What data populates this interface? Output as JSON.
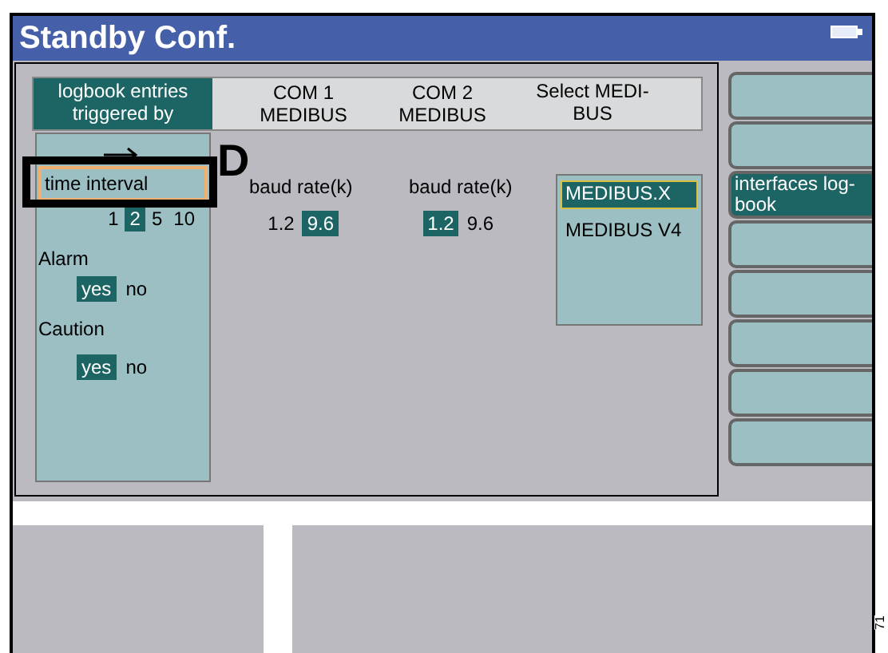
{
  "window": {
    "title": "Standby Conf."
  },
  "header": {
    "logbook_label": "logbook entries triggered by",
    "columns": [
      "COM 1 MEDIBUS",
      "COM 2 MEDIBUS",
      "Select MEDI-BUS"
    ]
  },
  "logbook": {
    "time_interval": {
      "label": "time interval",
      "selected": true
    },
    "interval_options": [
      {
        "label": "1",
        "selected": false
      },
      {
        "label": "2",
        "selected": true
      },
      {
        "label": "5",
        "selected": false
      },
      {
        "label": "10",
        "selected": false
      }
    ],
    "triggers": [
      {
        "label": "Alarm",
        "options": [
          {
            "label": "yes",
            "selected": true
          },
          {
            "label": "no",
            "selected": false
          }
        ]
      },
      {
        "label": "Caution",
        "options": [
          {
            "label": "yes",
            "selected": true
          },
          {
            "label": "no",
            "selected": false
          }
        ]
      }
    ]
  },
  "com_ports": [
    {
      "label": "baud rate(k)",
      "options": [
        {
          "label": "1.2",
          "selected": false
        },
        {
          "label": "9.6",
          "selected": true
        }
      ]
    },
    {
      "label": "baud rate(k)",
      "options": [
        {
          "label": "1.2",
          "selected": true
        },
        {
          "label": "9.6",
          "selected": false
        }
      ]
    }
  ],
  "medibus_select": [
    {
      "label": "MEDIBUS.X",
      "selected": true
    },
    {
      "label": "MEDIBUS V4",
      "selected": false
    }
  ],
  "side_buttons": [
    {
      "selected": false
    },
    {
      "selected": false
    },
    {
      "label": "interfaces log-book",
      "selected": true
    },
    {
      "selected": false
    },
    {
      "selected": false
    },
    {
      "selected": false
    },
    {
      "selected": false
    },
    {
      "selected": false
    }
  ],
  "annotation": {
    "letter": "D"
  },
  "figure_number": "71"
}
